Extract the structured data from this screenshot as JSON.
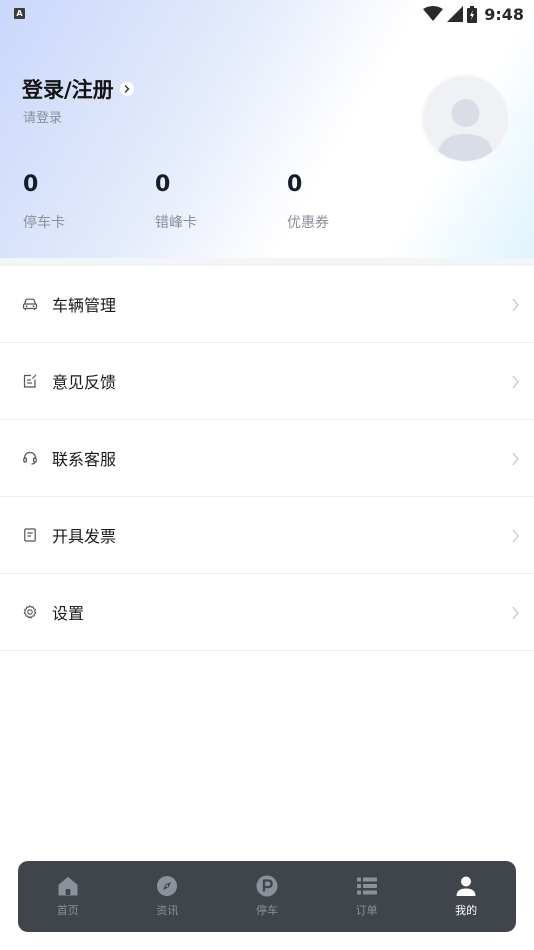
{
  "status_bar": {
    "badge": "A",
    "time": "9:48"
  },
  "profile": {
    "login_title": "登录/注册",
    "login_subtitle": "请登录"
  },
  "stats": [
    {
      "value": "0",
      "label": "停车卡"
    },
    {
      "value": "0",
      "label": "错峰卡"
    },
    {
      "value": "0",
      "label": "优惠券"
    }
  ],
  "menu": [
    {
      "label": "车辆管理",
      "icon": "car-icon"
    },
    {
      "label": "意见反馈",
      "icon": "feedback-edit-icon"
    },
    {
      "label": "联系客服",
      "icon": "headset-icon"
    },
    {
      "label": "开具发票",
      "icon": "invoice-icon"
    },
    {
      "label": "设置",
      "icon": "gear-icon"
    }
  ],
  "tabbar": {
    "active": "我的",
    "tabs": [
      {
        "label": "首页",
        "icon": "home-icon"
      },
      {
        "label": "资讯",
        "icon": "compass-icon"
      },
      {
        "label": "停车",
        "icon": "parking-icon"
      },
      {
        "label": "订单",
        "icon": "list-icon"
      },
      {
        "label": "我的",
        "icon": "person-icon"
      }
    ]
  },
  "colors": {
    "tabbar_bg": "#40444b",
    "tab_inactive": "#8c9099",
    "tab_active": "#ffffff",
    "header_gradient_start": "#c9d7fb",
    "header_gradient_end": "#dff4fd"
  }
}
